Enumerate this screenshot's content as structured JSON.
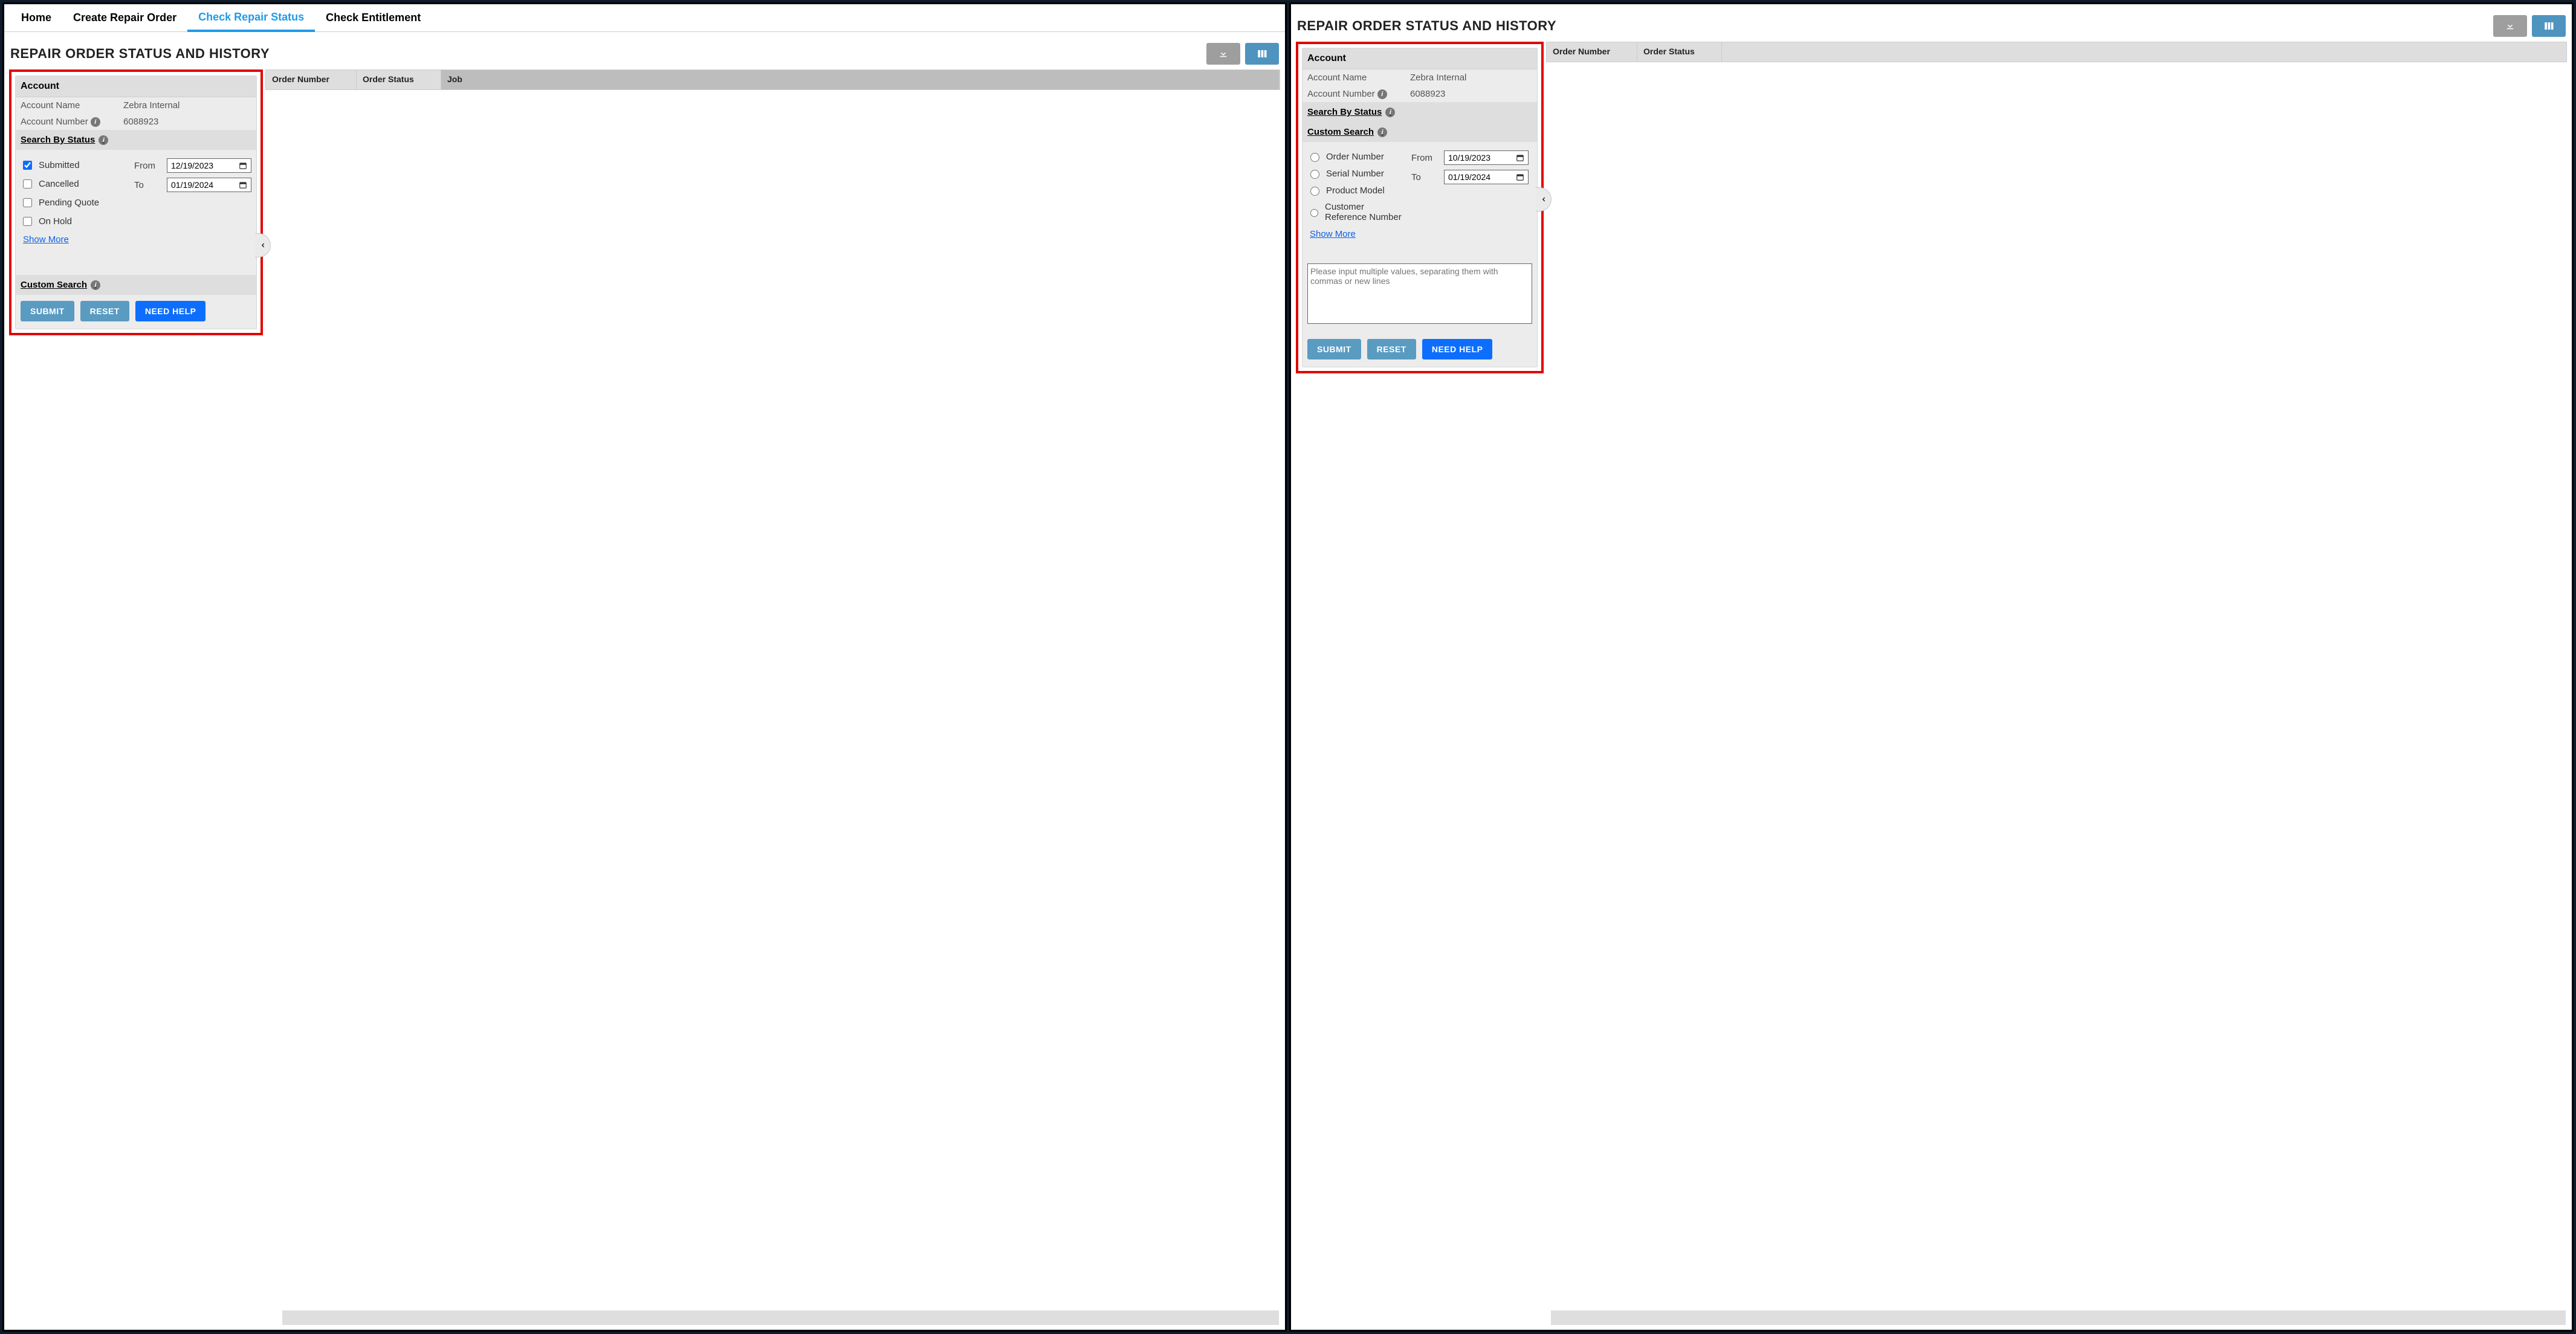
{
  "nav": {
    "home": "Home",
    "create": "Create Repair Order",
    "check_status": "Check Repair Status",
    "check_entitlement": "Check Entitlement"
  },
  "page_title": "REPAIR ORDER STATUS AND HISTORY",
  "account": {
    "header": "Account",
    "name_label": "Account Name",
    "name_value": "Zebra Internal",
    "number_label": "Account Number",
    "number_value": "6088923"
  },
  "search_by_status": {
    "header": "Search By Status",
    "submitted": "Submitted",
    "cancelled": "Cancelled",
    "pending_quote": "Pending Quote",
    "on_hold": "On Hold",
    "show_more": "Show More",
    "from_label": "From",
    "to_label": "To",
    "from_date": "12/19/2023",
    "to_date": "01/19/2024"
  },
  "custom_search": {
    "header": "Custom Search",
    "order_number": "Order Number",
    "serial_number": "Serial Number",
    "product_model": "Product Model",
    "cust_ref": "Customer Reference Number",
    "show_more": "Show More",
    "from_label": "From",
    "to_label": "To",
    "from_date": "10/19/2023",
    "to_date": "01/19/2024",
    "textarea_placeholder": "Please input multiple values, separating them with commas or new lines"
  },
  "buttons": {
    "submit": "SUBMIT",
    "reset": "RESET",
    "need_help": "NEED HELP"
  },
  "table": {
    "col_order_number": "Order Number",
    "col_order_status": "Order Status",
    "col_job": "Job"
  }
}
